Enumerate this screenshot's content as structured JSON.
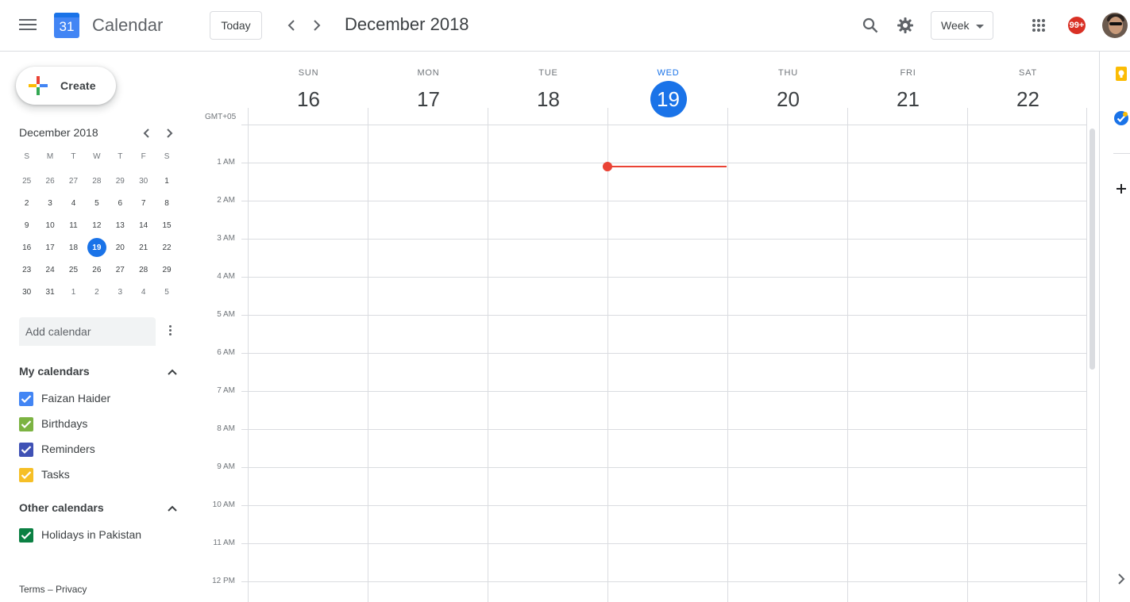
{
  "header": {
    "app_title": "Calendar",
    "logo_number": "31",
    "today_label": "Today",
    "date_title": "December 2018",
    "view_label": "Week",
    "notification_count": "99+"
  },
  "sidebar": {
    "create_label": "Create",
    "mini_calendar": {
      "title": "December 2018",
      "weekdays": [
        "S",
        "M",
        "T",
        "W",
        "T",
        "F",
        "S"
      ],
      "weeks": [
        [
          "25",
          "26",
          "27",
          "28",
          "29",
          "30",
          "1"
        ],
        [
          "2",
          "3",
          "4",
          "5",
          "6",
          "7",
          "8"
        ],
        [
          "9",
          "10",
          "11",
          "12",
          "13",
          "14",
          "15"
        ],
        [
          "16",
          "17",
          "18",
          "19",
          "20",
          "21",
          "22"
        ],
        [
          "23",
          "24",
          "25",
          "26",
          "27",
          "28",
          "29"
        ],
        [
          "30",
          "31",
          "1",
          "2",
          "3",
          "4",
          "5"
        ]
      ],
      "today": "19"
    },
    "add_calendar_placeholder": "Add calendar",
    "my_calendars_title": "My calendars",
    "my_calendars": [
      {
        "name": "Faizan Haider",
        "color": "#4285f4"
      },
      {
        "name": "Birthdays",
        "color": "#7cb342"
      },
      {
        "name": "Reminders",
        "color": "#3f51b5"
      },
      {
        "name": "Tasks",
        "color": "#f6bf26"
      }
    ],
    "other_calendars_title": "Other calendars",
    "other_calendars": [
      {
        "name": "Holidays in Pakistan",
        "color": "#0b8043"
      }
    ],
    "footer": {
      "terms": "Terms",
      "separator": "–",
      "privacy": "Privacy"
    }
  },
  "week": {
    "timezone": "GMT+05",
    "days": [
      {
        "dow": "SUN",
        "num": "16"
      },
      {
        "dow": "MON",
        "num": "17"
      },
      {
        "dow": "TUE",
        "num": "18"
      },
      {
        "dow": "WED",
        "num": "19",
        "current": true
      },
      {
        "dow": "THU",
        "num": "20"
      },
      {
        "dow": "FRI",
        "num": "21"
      },
      {
        "dow": "SAT",
        "num": "22"
      }
    ],
    "hours": [
      "1 AM",
      "2 AM",
      "3 AM",
      "4 AM",
      "5 AM",
      "6 AM",
      "7 AM",
      "8 AM",
      "9 AM",
      "10 AM",
      "11 AM",
      "12 PM"
    ]
  },
  "colors": {
    "accent": "#1a73e8",
    "current_time": "#ea4335",
    "keep_yellow": "#fbbc04",
    "tasks_blue": "#1a73e8"
  },
  "side_panel": {
    "icons": [
      "keep-icon",
      "tasks-icon",
      "add-addon-icon",
      "expand-panel-icon"
    ]
  }
}
